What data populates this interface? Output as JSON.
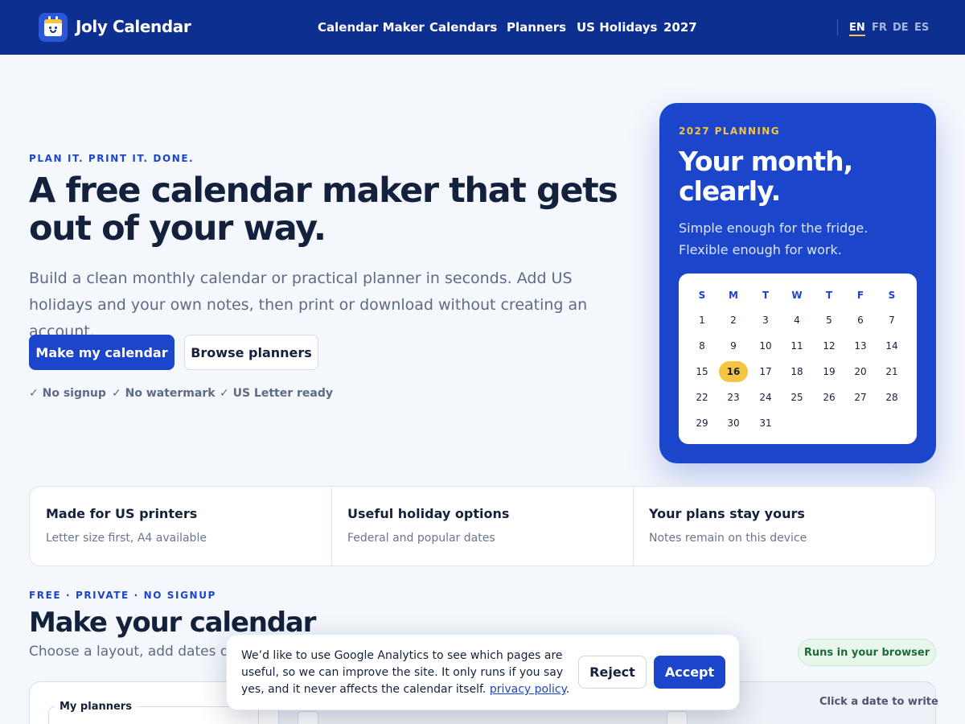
{
  "header": {
    "brand": "Joly Calendar",
    "nav": [
      "Calendar Maker",
      "Calendars",
      "Planners",
      "US Holidays",
      "2027"
    ],
    "languages": [
      "EN",
      "FR",
      "DE",
      "ES"
    ],
    "active_language": "EN"
  },
  "hero": {
    "eyebrow": "PLAN IT. PRINT IT. DONE.",
    "title": "A free calendar maker that gets out of your way.",
    "subtitle": "Build a clean monthly calendar or practical planner in seconds. Add US holidays and your own notes, then print or download without creating an account.",
    "primary_button": "Make my calendar",
    "secondary_button": "Browse planners",
    "perks": [
      "✓ No signup",
      "✓ No watermark",
      "✓ US Letter ready"
    ]
  },
  "planning_card": {
    "eyebrow": "2027 PLANNING",
    "title": "Your month, clearly.",
    "subtitle": "Simple enough for the fridge. Flexible enough for work.",
    "weekdays": [
      "S",
      "M",
      "T",
      "W",
      "T",
      "F",
      "S"
    ],
    "days": [
      "1",
      "2",
      "3",
      "4",
      "5",
      "6",
      "7",
      "8",
      "9",
      "10",
      "11",
      "12",
      "13",
      "14",
      "15",
      "16",
      "17",
      "18",
      "19",
      "20",
      "21",
      "22",
      "23",
      "24",
      "25",
      "26",
      "27",
      "28",
      "29",
      "30",
      "31"
    ],
    "highlighted_day": "16",
    "accent_color": "#f5c542"
  },
  "features": [
    {
      "title": "Made for US printers",
      "subtitle": "Letter size first, A4 available"
    },
    {
      "title": "Useful holiday options",
      "subtitle": "Federal and popular dates"
    },
    {
      "title": "Your plans stay yours",
      "subtitle": "Notes remain on this device"
    }
  ],
  "maker": {
    "eyebrow": "FREE · PRIVATE · NO SIGNUP",
    "title": "Make your calendar",
    "subtitle": "Choose a layout, add dates or no",
    "badge": "Runs in your browser",
    "my_planners_label": "My planners",
    "click_hint": "Click a date to write"
  },
  "cookie": {
    "text": "We’d like to use Google Analytics to see which pages are useful, so we can improve the site. It only runs if you say yes, and it never affects the calendar itself.",
    "link": "privacy policy",
    "reject": "Reject",
    "accept": "Accept"
  },
  "colors": {
    "header_bg": "#0d2f8f",
    "primary": "#1b46cc",
    "text_dark": "#14213d",
    "badge_green": "#1f6b3a"
  }
}
